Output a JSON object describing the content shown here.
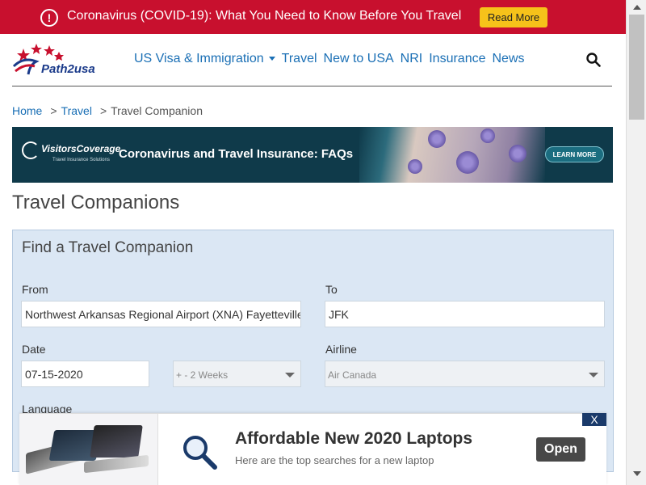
{
  "alert": {
    "text": "Coronavirus (COVID-19): What You Need to Know Before You Travel",
    "button": "Read More"
  },
  "header": {
    "logo_text": "Path2usa",
    "nav": [
      {
        "label": "US Visa & Immigration",
        "has_dropdown": true
      },
      {
        "label": "Travel"
      },
      {
        "label": "New to USA"
      },
      {
        "label": "NRI"
      },
      {
        "label": "Insurance"
      },
      {
        "label": "News"
      }
    ]
  },
  "breadcrumb": {
    "items": [
      "Home",
      "Travel",
      "Travel Companion"
    ],
    "separator": ">"
  },
  "ad_banner": {
    "brand": "VisitorsCoverage",
    "brand_sub": "Travel Insurance Solutions",
    "title": "Coronavirus and Travel Insurance: FAQs",
    "cta": "LEARN MORE"
  },
  "page": {
    "title": "Travel Companions"
  },
  "form": {
    "title": "Find a Travel Companion",
    "from_label": "From",
    "from_value": "Northwest Arkansas Regional Airport (XNA) Fayetteville",
    "to_label": "To",
    "to_value": "JFK",
    "date_label": "Date",
    "date_value": "07-15-2020",
    "range_value": "+ - 2 Weeks",
    "airline_label": "Airline",
    "airline_value": "Air Canada",
    "language_label": "Language"
  },
  "bottom_ad": {
    "close": "X",
    "headline": "Affordable New 2020 Laptops",
    "subtext": "Here are the top searches for a new laptop",
    "button": "Open"
  },
  "colors": {
    "alert_bg": "#c8102e",
    "alert_button": "#f6c21a",
    "link": "#1a6fb5",
    "panel_bg": "#dbe7f4",
    "ad_bg": "#0f3a4a"
  }
}
